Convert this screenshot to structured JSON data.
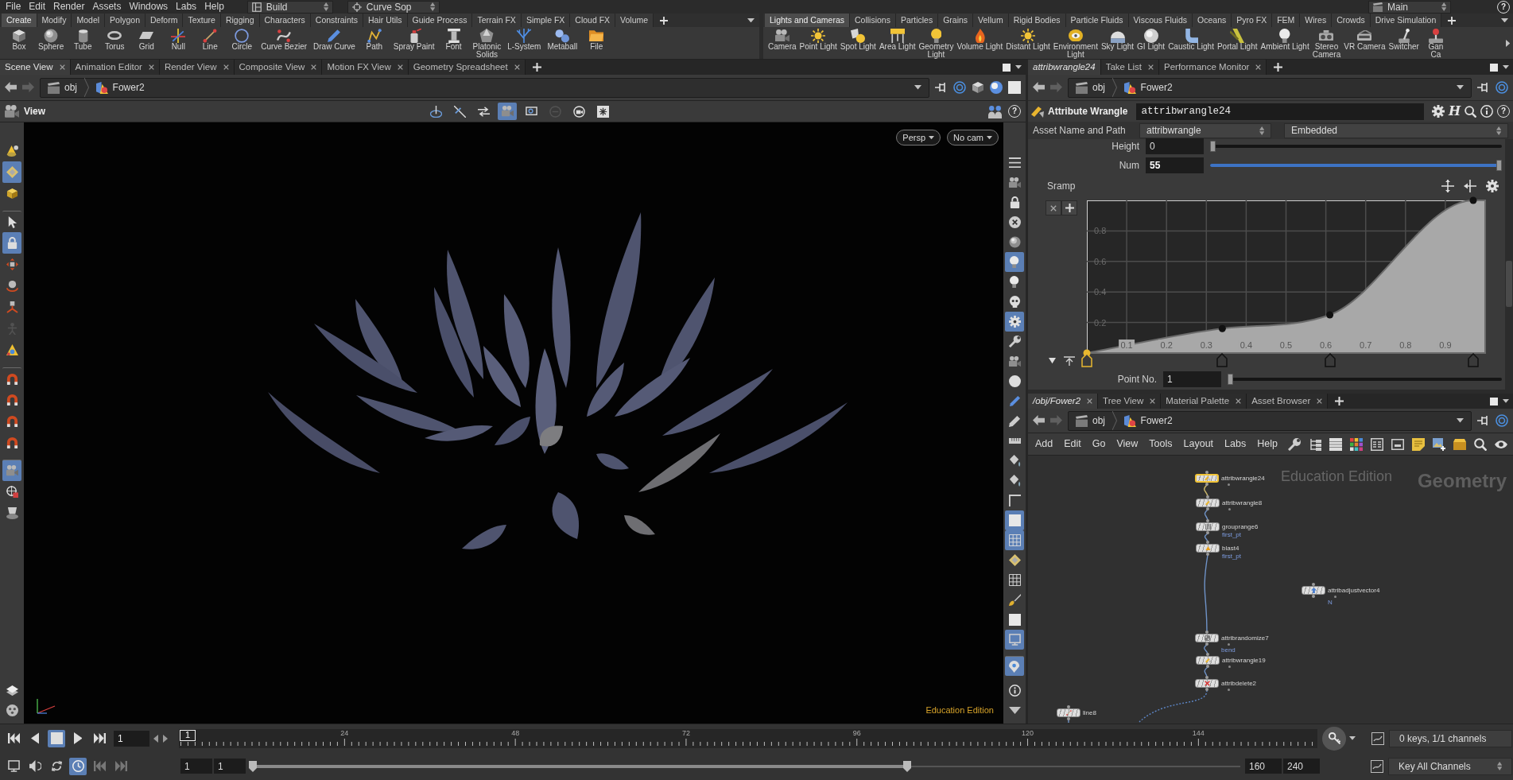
{
  "menu_bar": {
    "items": [
      "File",
      "Edit",
      "Render",
      "Assets",
      "Windows",
      "Labs",
      "Help"
    ],
    "desktop": "Build",
    "context": "Curve Sop",
    "main_desktop": "Main",
    "help": "?"
  },
  "shelf_left": {
    "tabs": [
      {
        "label": "Create",
        "selected": true
      },
      {
        "label": "Modify",
        "selected": false
      },
      {
        "label": "Model",
        "selected": false
      },
      {
        "label": "Polygon",
        "selected": false
      },
      {
        "label": "Deform",
        "selected": false
      },
      {
        "label": "Texture",
        "selected": false
      },
      {
        "label": "Rigging",
        "selected": false
      },
      {
        "label": "Characters",
        "selected": false
      },
      {
        "label": "Constraints",
        "selected": false
      },
      {
        "label": "Hair Utils",
        "selected": false
      },
      {
        "label": "Guide Process",
        "selected": false
      },
      {
        "label": "Terrain FX",
        "selected": false
      },
      {
        "label": "Simple FX",
        "selected": false
      },
      {
        "label": "Cloud FX",
        "selected": false
      },
      {
        "label": "Volume",
        "selected": false
      }
    ],
    "tools": [
      "Box",
      "Sphere",
      "Tube",
      "Torus",
      "Grid",
      "Null",
      "Line",
      "Circle",
      "Curve Bezier",
      "Draw Curve",
      "Path",
      "Spray Paint",
      "Font",
      "Platonic\nSolids",
      "L-System",
      "Metaball",
      "File"
    ]
  },
  "shelf_right": {
    "tabs": [
      {
        "label": "Lights and Cameras",
        "selected": true
      },
      {
        "label": "Collisions",
        "selected": false
      },
      {
        "label": "Particles",
        "selected": false
      },
      {
        "label": "Grains",
        "selected": false
      },
      {
        "label": "Vellum",
        "selected": false
      },
      {
        "label": "Rigid Bodies",
        "selected": false
      },
      {
        "label": "Particle Fluids",
        "selected": false
      },
      {
        "label": "Viscous Fluids",
        "selected": false
      },
      {
        "label": "Oceans",
        "selected": false
      },
      {
        "label": "Pyro FX",
        "selected": false
      },
      {
        "label": "FEM",
        "selected": false
      },
      {
        "label": "Wires",
        "selected": false
      },
      {
        "label": "Crowds",
        "selected": false
      },
      {
        "label": "Drive Simulation",
        "selected": false
      }
    ],
    "tools": [
      "Camera",
      "Point Light",
      "Spot Light",
      "Area Light",
      "Geometry\nLight",
      "Volume Light",
      "Distant Light",
      "Environment\nLight",
      "Sky Light",
      "GI Light",
      "Caustic Light",
      "Portal Light",
      "Ambient Light",
      "Stereo\nCamera",
      "VR Camera",
      "Switcher",
      "Gan\nCa"
    ]
  },
  "scene_pane": {
    "tabs": [
      {
        "label": "Scene View",
        "selected": true,
        "closable": true
      },
      {
        "label": "Animation Editor",
        "selected": false,
        "closable": true
      },
      {
        "label": "Render View",
        "selected": false,
        "closable": true
      },
      {
        "label": "Composite View",
        "selected": false,
        "closable": true
      },
      {
        "label": "Motion FX View",
        "selected": false,
        "closable": true
      },
      {
        "label": "Geometry Spreadsheet",
        "selected": false,
        "closable": true
      }
    ],
    "path": [
      "obj",
      "Fower2"
    ],
    "toolbar_label": "View",
    "view_tools": [
      {
        "kind": "orbit",
        "selected": false,
        "disabled": false
      },
      {
        "kind": "crosslines",
        "selected": false,
        "disabled": false
      },
      {
        "kind": "swap",
        "selected": false,
        "disabled": false
      },
      {
        "kind": "camera",
        "selected": true,
        "disabled": false
      },
      {
        "kind": "zoombox",
        "selected": false,
        "disabled": false
      },
      {
        "kind": "minuscircle",
        "selected": false,
        "disabled": true
      },
      {
        "kind": "camring",
        "selected": false,
        "disabled": false
      },
      {
        "kind": "flake",
        "selected": false,
        "disabled": false
      }
    ],
    "help": "?",
    "left_tools": {
      "top": [
        {
          "kind": "cone",
          "selected": false,
          "disabled": false,
          "divider": false
        },
        {
          "kind": "diamond",
          "selected": true,
          "disabled": false,
          "divider": false
        },
        {
          "kind": "cube",
          "selected": false,
          "disabled": false,
          "divider": false
        },
        {
          "kind": "pointer",
          "selected": false,
          "disabled": false,
          "divider": true
        },
        {
          "kind": "lock",
          "selected": true,
          "disabled": false,
          "divider": false
        },
        {
          "kind": "move",
          "selected": false,
          "disabled": false,
          "divider": false
        },
        {
          "kind": "rotate",
          "selected": false,
          "disabled": false,
          "divider": false
        },
        {
          "kind": "scale",
          "selected": false,
          "disabled": false,
          "divider": false
        },
        {
          "kind": "figure",
          "selected": false,
          "disabled": true,
          "divider": false
        },
        {
          "kind": "handle",
          "selected": false,
          "disabled": false,
          "divider": false
        },
        {
          "kind": "magnet",
          "selected": false,
          "disabled": false,
          "divider": true
        },
        {
          "kind": "magnet",
          "selected": false,
          "disabled": false,
          "divider": false
        },
        {
          "kind": "magnet",
          "selected": false,
          "disabled": false,
          "divider": false
        },
        {
          "kind": "magnet",
          "selected": false,
          "disabled": false,
          "divider": false
        },
        {
          "kind": "camera",
          "selected": true,
          "disabled": false,
          "divider": true
        },
        {
          "kind": "crosshair",
          "selected": false,
          "disabled": false,
          "divider": false
        },
        {
          "kind": "lamp",
          "selected": false,
          "disabled": false,
          "divider": false
        }
      ],
      "bottom": [
        {
          "kind": "layers",
          "selected": false,
          "disabled": false,
          "divider": false
        },
        {
          "kind": "reel",
          "selected": false,
          "disabled": false,
          "divider": false
        }
      ]
    },
    "right_tools": {
      "top": [
        {
          "kind": "lines",
          "selected": false,
          "divider": false
        },
        {
          "kind": "camera",
          "selected": false,
          "divider": false
        },
        {
          "kind": "lock",
          "selected": false,
          "divider": false
        },
        {
          "kind": "xcircle",
          "selected": false,
          "divider": false
        },
        {
          "kind": "sphere",
          "selected": false,
          "divider": false
        },
        {
          "kind": "bulb",
          "selected": true,
          "divider": false
        },
        {
          "kind": "bulb",
          "selected": false,
          "divider": false
        },
        {
          "kind": "skull",
          "selected": false,
          "divider": false
        },
        {
          "kind": "gear",
          "selected": true,
          "divider": false
        },
        {
          "kind": "wrench",
          "selected": false,
          "divider": false
        },
        {
          "kind": "camera",
          "selected": false,
          "divider": false
        },
        {
          "kind": "dot",
          "selected": false,
          "divider": false
        },
        {
          "kind": "pen",
          "selected": false,
          "divider": false
        },
        {
          "kind": "pencil",
          "selected": false,
          "divider": false
        },
        {
          "kind": "ruler",
          "selected": false,
          "divider": false
        },
        {
          "kind": "bucket",
          "selected": false,
          "divider": false
        },
        {
          "kind": "bucket",
          "selected": false,
          "divider": false
        },
        {
          "kind": "corner",
          "selected": false,
          "divider": false
        },
        {
          "kind": "square",
          "selected": true,
          "divider": false
        },
        {
          "kind": "grid",
          "selected": true,
          "divider": false
        },
        {
          "kind": "diamond",
          "selected": false,
          "divider": false
        },
        {
          "kind": "grid",
          "selected": false,
          "divider": false
        },
        {
          "kind": "brush",
          "selected": false,
          "divider": false
        },
        {
          "kind": "square",
          "selected": false,
          "divider": false
        },
        {
          "kind": "monitor",
          "selected": true,
          "divider": false
        },
        {
          "kind": "pin",
          "selected": true,
          "divider": true
        }
      ],
      "bottom": [
        {
          "kind": "info",
          "selected": false,
          "divider": false
        },
        {
          "kind": "caret",
          "selected": false,
          "divider": false
        }
      ]
    },
    "camera_menus": [
      "Persp",
      "No cam"
    ],
    "edition_label": "Education Edition"
  },
  "parameter_pane": {
    "tabs": [
      {
        "label": "attribwrangle24",
        "selected": true,
        "closable": false,
        "kind": "path"
      },
      {
        "label": "Take List",
        "selected": false,
        "closable": true,
        "kind": "pane"
      },
      {
        "label": "Performance Monitor",
        "selected": false,
        "closable": true,
        "kind": "pane"
      }
    ],
    "path": [
      "obj",
      "Fower2"
    ],
    "node_type": "Attribute Wrangle",
    "node_name": "attribwrangle24",
    "help_glyph": "H",
    "help": "?",
    "asset_label": "Asset Name and Path",
    "asset_name": "attribwrangle",
    "asset_location": "Embedded",
    "parameters": [
      {
        "label": "Height",
        "value": "0",
        "modified": false,
        "level": 0
      },
      {
        "label": "Num",
        "value": "55",
        "modified": true,
        "level": 1
      }
    ],
    "ramp": {
      "chart_data": {
        "type": "area",
        "title": "Sramp",
        "x": [
          0,
          0.34,
          0.61,
          0.97,
          1
        ],
        "series": [
          {
            "values": [
              0,
              0.16,
              0.25,
              1,
              1
            ]
          }
        ],
        "xlim": [
          0,
          1
        ],
        "ylim": [
          0,
          1
        ],
        "xticks": [
          0.1,
          0.2,
          0.3,
          0.4,
          0.5,
          0.6,
          0.7,
          0.8,
          0.9
        ],
        "yticks": [
          0.2,
          0.4,
          0.6,
          0.8
        ],
        "grid": true
      },
      "keys": [
        {
          "selected": true
        },
        {
          "selected": false
        },
        {
          "selected": false
        },
        {
          "selected": false
        }
      ]
    },
    "point_field": {
      "label": "Point No.",
      "value": "1",
      "modified": false,
      "level": 0
    }
  },
  "network_pane": {
    "tabs": [
      {
        "label": "/obj/Fower2",
        "selected": true,
        "closable": true,
        "kind": "path"
      },
      {
        "label": "Tree View",
        "selected": false,
        "closable": true,
        "kind": "pane"
      },
      {
        "label": "Material Palette",
        "selected": false,
        "closable": true,
        "kind": "pane"
      },
      {
        "label": "Asset Browser",
        "selected": false,
        "closable": true,
        "kind": "pane"
      }
    ],
    "path": [
      "obj",
      "Fower2"
    ],
    "menu": [
      "Add",
      "Edit",
      "Go",
      "View",
      "Tools",
      "Layout",
      "Labs",
      "Help"
    ],
    "watermark": "Education Edition",
    "context_label": "Geometry",
    "nodes": [
      {
        "name": "attribwrangle24",
        "kind": "wrangle",
        "selected": true,
        "indicator": true,
        "output": {
          "kind": "next"
        }
      },
      {
        "name": "attribwrangle8",
        "kind": "wrangle",
        "selected": false,
        "indicator": true,
        "output": {
          "kind": "next"
        }
      },
      {
        "name": "grouprange6",
        "kind": "grouprange",
        "selected": false,
        "indicator": false,
        "note": "first_pt",
        "output": {
          "kind": "next"
        }
      },
      {
        "name": "blast4",
        "kind": "blast",
        "selected": false,
        "indicator": false,
        "note": "first_pt",
        "output": {
          "kind": "next"
        }
      },
      {
        "name": "attribrandomize7",
        "kind": "randomize",
        "selected": false,
        "indicator": true,
        "note": "bend",
        "output": {
          "kind": "next"
        }
      },
      {
        "name": "attribwrangle19",
        "kind": "wrangle",
        "selected": false,
        "indicator": true,
        "output": {
          "kind": "next"
        }
      },
      {
        "name": "attribdelete2",
        "kind": "delete",
        "selected": false,
        "indicator": true,
        "output": {
          "kind": "dotted"
        }
      },
      {
        "name": "attribadjustvector4",
        "kind": "adjust",
        "selected": false,
        "indicator": true,
        "note": "N"
      },
      {
        "name": "line8",
        "kind": "line",
        "selected": false,
        "indicator": false,
        "output": {
          "kind": "stub"
        }
      }
    ]
  },
  "timeline": {
    "transport": [
      {
        "kind": "first",
        "selected": false
      },
      {
        "kind": "back",
        "selected": false
      },
      {
        "kind": "stop",
        "selected": true
      },
      {
        "kind": "play",
        "selected": false
      },
      {
        "kind": "last",
        "selected": false
      }
    ],
    "frame_field": "1",
    "playhead_label": "1",
    "tick_labels": [
      "24",
      "48",
      "72",
      "96",
      "120",
      "144"
    ],
    "keys_status": "0 keys, 1/1 channels",
    "options": [
      {
        "kind": "display",
        "on": false,
        "disabled": false
      },
      {
        "kind": "audio",
        "on": false,
        "disabled": false
      },
      {
        "kind": "loop",
        "on": false,
        "disabled": false
      },
      {
        "kind": "realtime",
        "on": true,
        "disabled": false
      },
      {
        "kind": "first",
        "on": false,
        "disabled": true
      },
      {
        "kind": "last",
        "on": false,
        "disabled": true
      }
    ],
    "range_start": [
      "1",
      "1"
    ],
    "range_slider": {
      "level": 0.665
    },
    "range_end": [
      "160",
      "240"
    ],
    "key_mode": "Key All Channels"
  }
}
